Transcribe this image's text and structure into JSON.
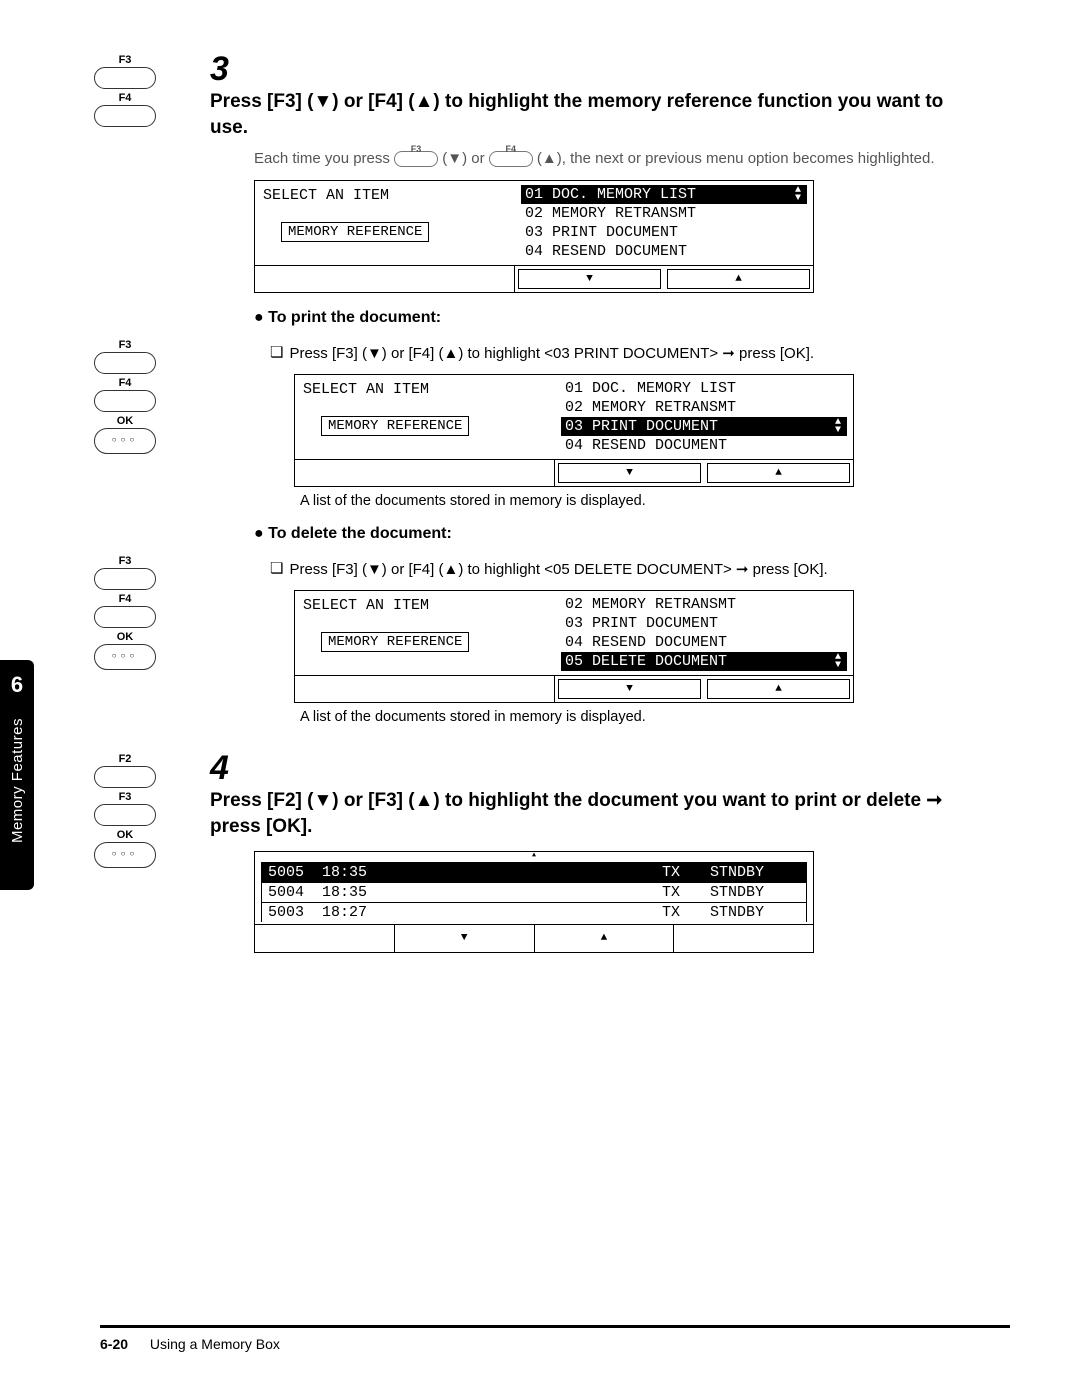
{
  "sidebar": {
    "chapter": "6",
    "label": "Memory Features"
  },
  "step3": {
    "num": "3",
    "title": "Press [F3] (▼) or [F4] (▲) to highlight the memory reference function you want to use.",
    "body_a": "Each time you press ",
    "body_b": " (▼) or ",
    "body_c": " (▲), the next or previous menu option becomes highlighted.",
    "key_f3": "F3",
    "key_f4": "F4",
    "screen1": {
      "select": "SELECT AN ITEM",
      "memref": "MEMORY REFERENCE",
      "items": [
        "01 DOC. MEMORY LIST",
        "02 MEMORY RETRANSMT",
        "03 PRINT DOCUMENT",
        "04 RESEND DOCUMENT"
      ],
      "sel_index": 0
    },
    "print_hdr": "To print the document:",
    "print_step": "Press [F3] (▼) or [F4] (▲) to highlight <03 PRINT DOCUMENT> ➞ press [OK].",
    "screen2": {
      "select": "SELECT AN ITEM",
      "memref": "MEMORY REFERENCE",
      "items": [
        "01 DOC. MEMORY LIST",
        "02 MEMORY RETRANSMT",
        "03 PRINT DOCUMENT",
        "04 RESEND DOCUMENT"
      ],
      "sel_index": 2
    },
    "caption": "A list of the documents stored in memory is displayed.",
    "delete_hdr": "To delete the document:",
    "delete_step": "Press [F3] (▼) or [F4] (▲) to highlight <05 DELETE DOCUMENT> ➞ press [OK].",
    "screen3": {
      "select": "SELECT AN ITEM",
      "memref": "MEMORY REFERENCE",
      "items": [
        "02 MEMORY RETRANSMT",
        "03 PRINT DOCUMENT",
        "04 RESEND DOCUMENT",
        "05 DELETE DOCUMENT"
      ],
      "sel_index": 3
    }
  },
  "step4": {
    "num": "4",
    "title": "Press [F2] (▼) or [F3] (▲) to highlight the document you want to print or delete ➞ press [OK].",
    "key_f2": "F2",
    "key_f3": "F3",
    "key_ok": "OK",
    "list": {
      "rows": [
        {
          "id": "5005",
          "time": "18:35",
          "dir": "TX",
          "status": "STNDBY",
          "sel": true
        },
        {
          "id": "5004",
          "time": "18:35",
          "dir": "TX",
          "status": "STNDBY",
          "sel": false
        },
        {
          "id": "5003",
          "time": "18:27",
          "dir": "TX",
          "status": "STNDBY",
          "sel": false
        }
      ]
    }
  },
  "keys": {
    "f2": "F2",
    "f3": "F3",
    "f4": "F4",
    "ok": "OK"
  },
  "footer": {
    "page": "6-20",
    "title": "Using a Memory Box"
  }
}
